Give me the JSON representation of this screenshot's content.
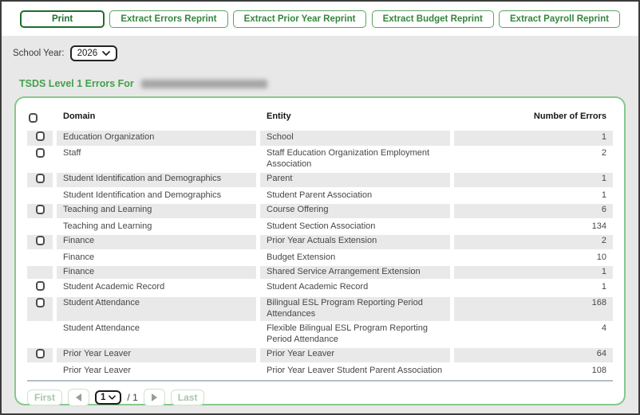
{
  "toolbar": {
    "buttons": [
      "Print",
      "Extract Errors Reprint",
      "Extract Prior Year Reprint",
      "Extract Budget Reprint",
      "Extract Payroll Reprint"
    ]
  },
  "filters": {
    "school_year_label": "School Year:",
    "school_year_value": "2026"
  },
  "heading": {
    "title": "TSDS Level 1 Errors For",
    "redacted_suffix": true
  },
  "table": {
    "columns": [
      "Domain",
      "Entity",
      "Number of Errors"
    ],
    "rows": [
      {
        "domain": "Education Organization",
        "entity": "School",
        "errors": "1",
        "checkbox": true,
        "shaded": true
      },
      {
        "domain": "Staff",
        "entity": "Staff Education Organization Employment Association",
        "errors": "2",
        "checkbox": true,
        "shaded": false
      },
      {
        "domain": "Student Identification and Demographics",
        "entity": "Parent",
        "errors": "1",
        "checkbox": true,
        "shaded": true
      },
      {
        "domain": "Student Identification and Demographics",
        "entity": "Student Parent Association",
        "errors": "1",
        "checkbox": false,
        "shaded": false
      },
      {
        "domain": "Teaching and Learning",
        "entity": "Course Offering",
        "errors": "6",
        "checkbox": true,
        "shaded": true
      },
      {
        "domain": "Teaching and Learning",
        "entity": "Student Section Association",
        "errors": "134",
        "checkbox": false,
        "shaded": false
      },
      {
        "domain": "Finance",
        "entity": "Prior Year Actuals Extension",
        "errors": "2",
        "checkbox": true,
        "shaded": true
      },
      {
        "domain": "Finance",
        "entity": "Budget Extension",
        "errors": "10",
        "checkbox": false,
        "shaded": false
      },
      {
        "domain": "Finance",
        "entity": "Shared Service Arrangement Extension",
        "errors": "1",
        "checkbox": false,
        "shaded": true
      },
      {
        "domain": "Student Academic Record",
        "entity": "Student Academic Record",
        "errors": "1",
        "checkbox": true,
        "shaded": false
      },
      {
        "domain": "Student Attendance",
        "entity": "Bilingual ESL Program Reporting Period Attendances",
        "errors": "168",
        "checkbox": true,
        "shaded": true
      },
      {
        "domain": "Student Attendance",
        "entity": "Flexible Bilingual ESL Program Reporting Period Attendance",
        "errors": "4",
        "checkbox": false,
        "shaded": false
      },
      {
        "domain": "Prior Year Leaver",
        "entity": "Prior Year Leaver",
        "errors": "64",
        "checkbox": true,
        "shaded": true
      },
      {
        "domain": "Prior Year Leaver",
        "entity": "Prior Year Leaver Student Parent Association",
        "errors": "108",
        "checkbox": false,
        "shaded": false
      }
    ]
  },
  "pagination": {
    "first": "First",
    "last": "Last",
    "page": "1",
    "of": "/ 1"
  },
  "icons": {
    "chevron_down": "chevron-down",
    "prev": "triangle-left",
    "next": "triangle-right"
  },
  "colors": {
    "primary_green": "#1d6f2b",
    "button_green": "#35853c",
    "heading_green": "#44a04c",
    "panel_border_green": "#85ca8a",
    "shaded_row": "#e9e9e9",
    "content_background": "#e8e8e8"
  }
}
